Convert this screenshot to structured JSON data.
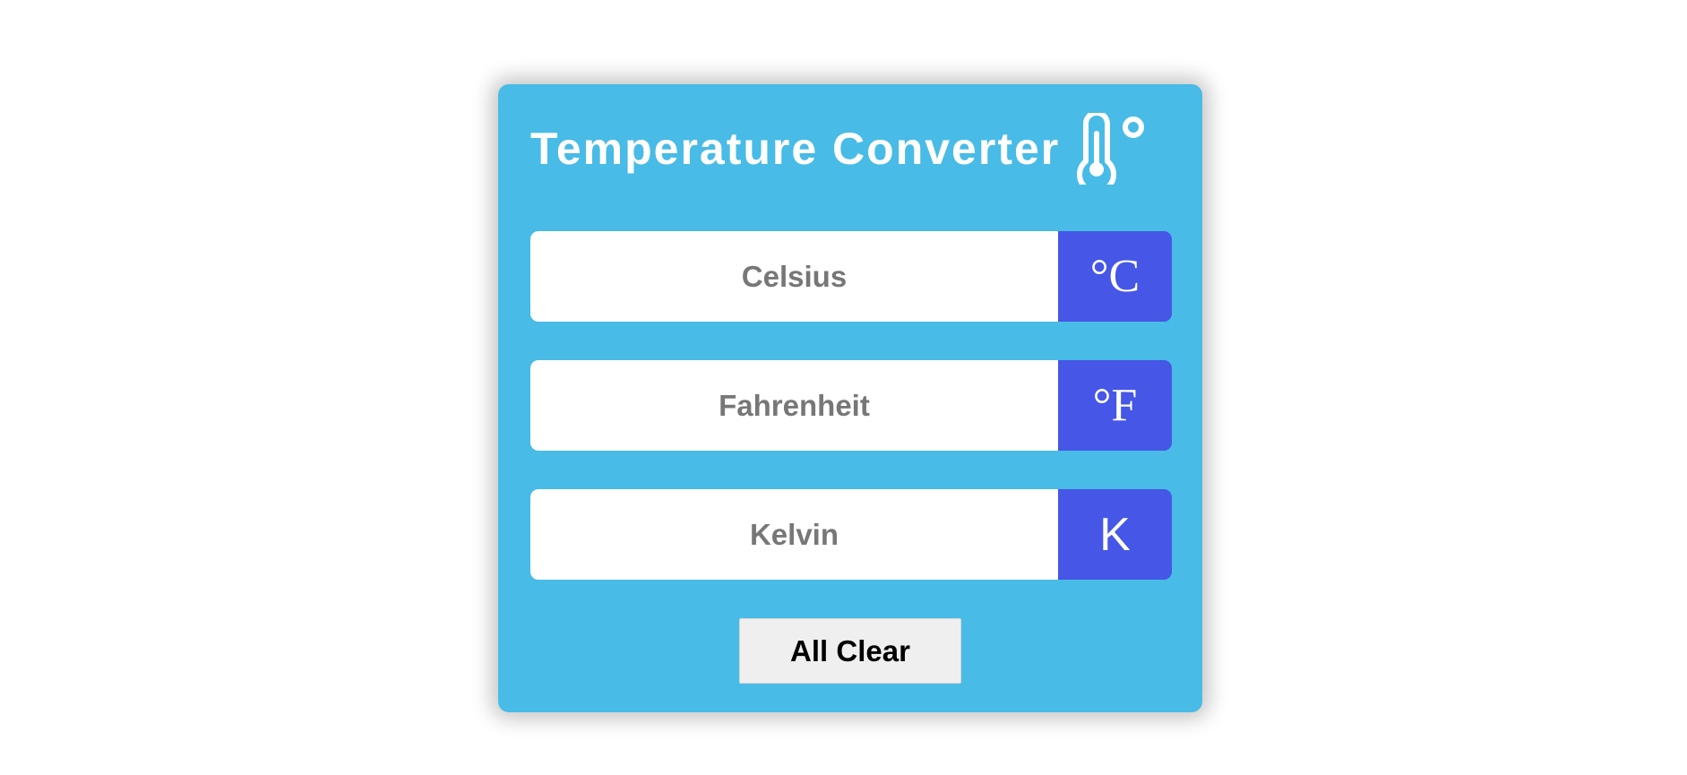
{
  "app": {
    "title": "Temperature Converter",
    "title_icon": "thermometer-degree-icon"
  },
  "fields": [
    {
      "placeholder": "Celsius",
      "value": "",
      "unit": "°C"
    },
    {
      "placeholder": "Fahrenheit",
      "value": "",
      "unit": "°F"
    },
    {
      "placeholder": "Kelvin",
      "value": "",
      "unit": "K"
    }
  ],
  "actions": {
    "clear_label": "All Clear"
  },
  "colors": {
    "card_background": "#48bbe6",
    "unit_background": "#4656e6",
    "field_background": "#ffffff",
    "placeholder_text": "#777777",
    "button_background": "#efefef"
  }
}
